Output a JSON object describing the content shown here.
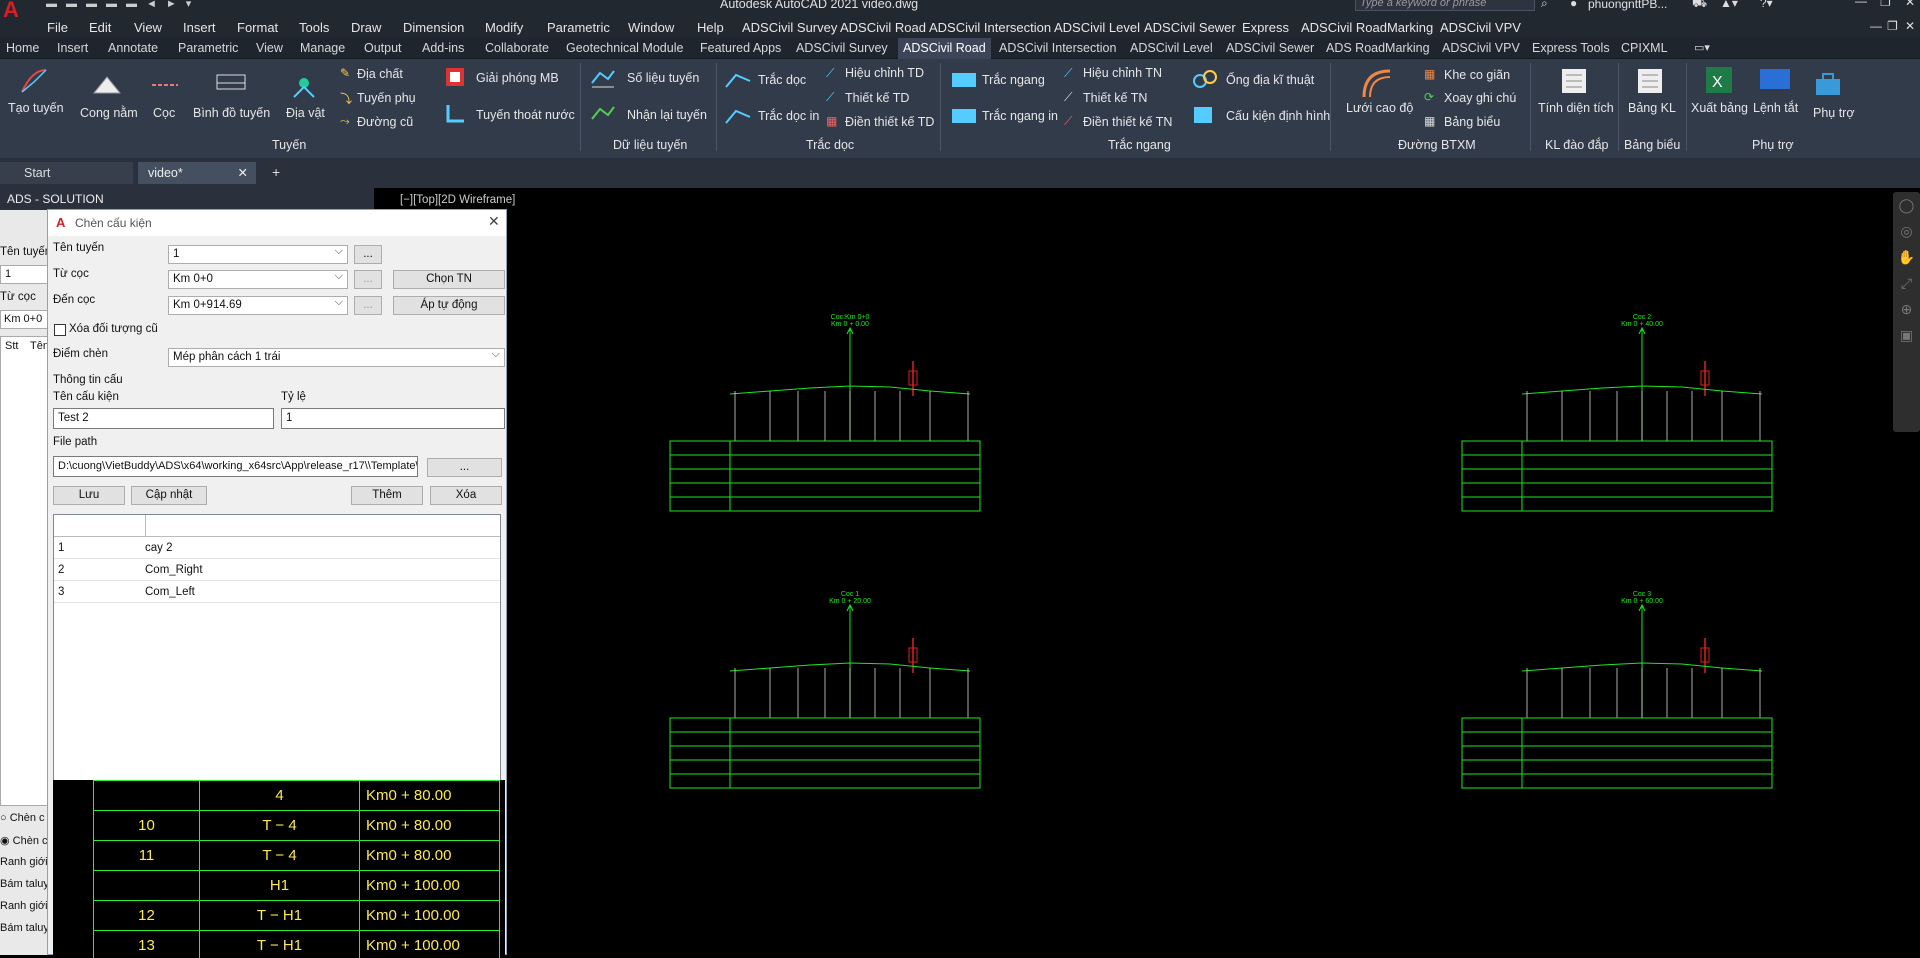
{
  "app": {
    "title": "Autodesk AutoCAD 2021   video.dwg",
    "search_placeholder": "Type a keyword or phrase",
    "user": "phuongnttPB..."
  },
  "menu": [
    "File",
    "Edit",
    "View",
    "Insert",
    "Format",
    "Tools",
    "Draw",
    "Dimension",
    "Modify",
    "Parametric",
    "Window",
    "Help",
    "ADSCivil Survey",
    "ADSCivil Road",
    "ADSCivil Intersection",
    "ADSCivil Level",
    "ADSCivil Sewer",
    "Express",
    "ADSCivil RoadMarking",
    "ADSCivil VPV"
  ],
  "ribbon_tabs": [
    "Home",
    "Insert",
    "Annotate",
    "Parametric",
    "View",
    "Manage",
    "Output",
    "Add-ins",
    "Collaborate",
    "Geotechnical Module",
    "Featured Apps",
    "ADSCivil Survey",
    "ADSCivil Road",
    "ADSCivil Intersection",
    "ADSCivil Level",
    "ADSCivil Sewer",
    "ADS RoadMarking",
    "ADSCivil VPV",
    "Express Tools",
    "CPIXML"
  ],
  "ribbon_active": "ADSCivil Road",
  "ribbon": {
    "tao_tuyen": "Tạo tuyến",
    "cong_nam": "Cong nằm",
    "coc": "Cọc",
    "binh_do_tuyen": "Bình đồ tuyến",
    "dia_vat": "Địa vật",
    "dia_chat": "Địa chất",
    "tuyen_phu": "Tuyến phụ",
    "duong_cu": "Đường cũ",
    "giai_phong_mb": "Giải phóng MB",
    "tuyen_thoat_nuoc": "Tuyến thoát nước",
    "so_lieu_tuyen": "Số liệu tuyến",
    "nhan_lai_tuyen": "Nhận lại tuyến",
    "trac_doc": "Trắc dọc",
    "trac_doc_in": "Trắc dọc in",
    "hieu_chinh_td": "Hiệu chỉnh TD",
    "thiet_ke_td": "Thiết kế TD",
    "dien_thiet_ke_td": "Điền thiết kế TD",
    "trac_ngang": "Trắc ngang",
    "trac_ngang_in": "Trắc ngang in",
    "hieu_chinh_tn": "Hiệu chỉnh TN",
    "thiet_ke_tn": "Thiết kế TN",
    "dien_thiet_ke_tn": "Điền thiết kế TN",
    "ong_dia_ki_thuat": "Ống địa kĩ thuật",
    "cau_kien_dinh_hinh": "Cấu kiện định hình",
    "luoi_cao_do": "Lưới cao độ",
    "khe_co_gian": "Khe co giãn",
    "xoay_ghi_chu": "Xoay ghi chú",
    "bang_bieu": "Bảng biểu",
    "tinh_dien_tich": "Tính diện tích",
    "bang_kl": "Bảng KL",
    "xuat_bang": "Xuất bảng",
    "lenh_tat": "Lệnh tắt",
    "phu_tro": "Phụ trợ",
    "groups": {
      "tuyen": "Tuyến",
      "du_lieu_tuyen": "Dữ liệu tuyến",
      "trac_doc": "Trắc dọc",
      "trac_ngang": "Trắc ngang",
      "duong_btxm": "Đường BTXM",
      "kl_dao_dap": "KL đào đắp",
      "bang_bieu": "Bảng biểu",
      "phu_tro": "Phụ trợ"
    }
  },
  "doc_tabs": {
    "start": "Start",
    "video": "video*",
    "add": "+"
  },
  "viewport_label": "[−][Top][2D Wireframe]",
  "left_panel": {
    "title": "ADS - SOLUTION",
    "ten_tuyen": "Tên tuyến",
    "value_1": "1",
    "tu_coc": "Từ cọc",
    "km": "Km 0+0",
    "stt": "Stt",
    "ten": "Tên",
    "chen1": "Chèn c",
    "chen2": "Chèn c",
    "ranh1": "Ranh giới",
    "bam1": "Bám taluy",
    "ranh2": "Ranh giới",
    "bam2": "Bám taluy"
  },
  "dialog": {
    "title": "Chèn cấu kiện",
    "ten_tuyen_label": "Tên tuyến",
    "ten_tuyen_value": "1",
    "tu_coc_label": "Từ cọc",
    "tu_coc_value": "Km 0+0",
    "den_coc_label": "Đến cọc",
    "den_coc_value": "Km 0+914.69",
    "browse": "...",
    "chon_tn": "Chọn TN",
    "ap_tu_dong": "Áp tự động",
    "xoa_doi_tuong_cu": "Xóa đối tượng cũ",
    "diem_chen_label": "Điểm chèn",
    "diem_chen_value": "Mép phân cách 1 trái",
    "thong_tin_cau": "Thông tin cấu",
    "ten_cau_kien_label": "Tên cấu kiện",
    "ten_cau_kien_value": "Test 2",
    "ty_le_label": "Tỷ lệ",
    "ty_le_value": "1",
    "file_path_label": "File path",
    "file_path_value": "D:\\cuong\\VietBuddy\\ADS\\x64\\working_x64src\\App\\release_r17\\\\Template\\",
    "luu": "Lưu",
    "cap_nhat": "Cập nhật",
    "them": "Thêm",
    "xoa": "Xóa",
    "rows": [
      {
        "no": "1",
        "name": "cay 2"
      },
      {
        "no": "2",
        "name": "Com_Right"
      },
      {
        "no": "3",
        "name": "Com_Left"
      }
    ]
  },
  "yellow_table": [
    [
      "",
      "4",
      "Km0 + 80.00"
    ],
    [
      "10",
      "T − 4",
      "Km0 + 80.00"
    ],
    [
      "11",
      "T − 4",
      "Km0 + 80.00"
    ],
    [
      "",
      "H1",
      "Km0 + 100.00"
    ],
    [
      "12",
      "T − H1",
      "Km0 + 100.00"
    ],
    [
      "13",
      "T − H1",
      "Km0 + 100.00"
    ]
  ],
  "cad_sections": [
    {
      "coc": "Coc:Km 0+0",
      "km": "Km 0 + 0.00"
    },
    {
      "coc": "Coc 2",
      "km": "Km 0 + 40.00"
    },
    {
      "coc": "Coc 1",
      "km": "Km 0 + 20.00"
    },
    {
      "coc": "Coc 3",
      "km": "Km 0 + 60.00"
    }
  ]
}
